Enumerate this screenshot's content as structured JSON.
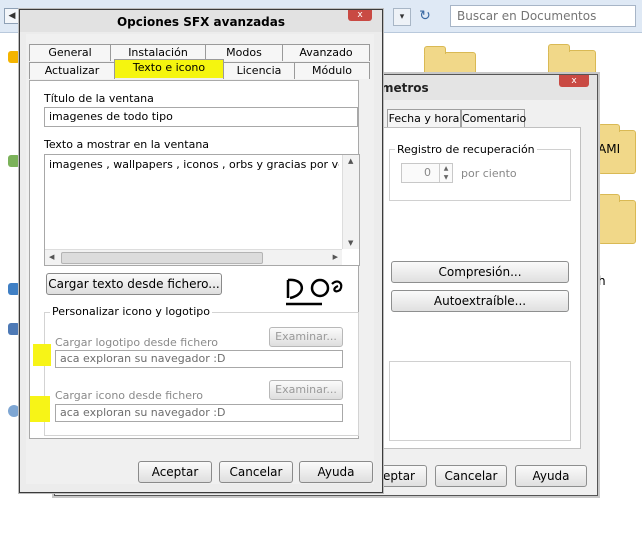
{
  "explorer": {
    "search_placeholder": "Buscar en Documentos",
    "folder_labels": [
      "AMI",
      "h"
    ]
  },
  "back_dialog": {
    "title": "metros",
    "tabs": [
      "Fecha y hora",
      "Comentario"
    ],
    "recovery_label": "Registro de recuperación",
    "recovery_value": "0",
    "recovery_unit": "por ciento",
    "compression_button": "Compresión...",
    "selfextract_button": "Autoextraíble...",
    "accept_button": "eptar",
    "cancel_button": "Cancelar",
    "help_button": "Ayuda"
  },
  "dialog": {
    "title": "Opciones SFX avanzadas",
    "close_label": "x",
    "tabs_row1": [
      "General",
      "Instalación",
      "Modos",
      "Avanzado"
    ],
    "tabs_row2": [
      "Actualizar",
      "Texto e icono",
      "Licencia",
      "Módulo"
    ],
    "active_tab": "Texto e icono",
    "window_title_label": "Título de la ventana",
    "window_title_value": "imagenes de todo tipo",
    "window_text_label": "Texto a mostrar en la ventana",
    "window_text_value": "imagenes , wallpapers , iconos , orbs y gracias por ver el po",
    "load_text_button": "Cargar texto desde fichero...",
    "doodle_text": "Do",
    "group_label": "Personalizar icono y logotipo",
    "logo_label": "Cargar logotipo desde fichero",
    "logo_value": "aca exploran su navegador :D",
    "icon_label": "Cargar icono desde fichero",
    "icon_value": "aca exploran su navegador :D",
    "browse_button": "Examinar...",
    "accept_button": "Aceptar",
    "cancel_button": "Cancelar",
    "help_button": "Ayuda"
  },
  "colors": {
    "highlight": "#f7f417",
    "close_red": "#c94a43"
  }
}
